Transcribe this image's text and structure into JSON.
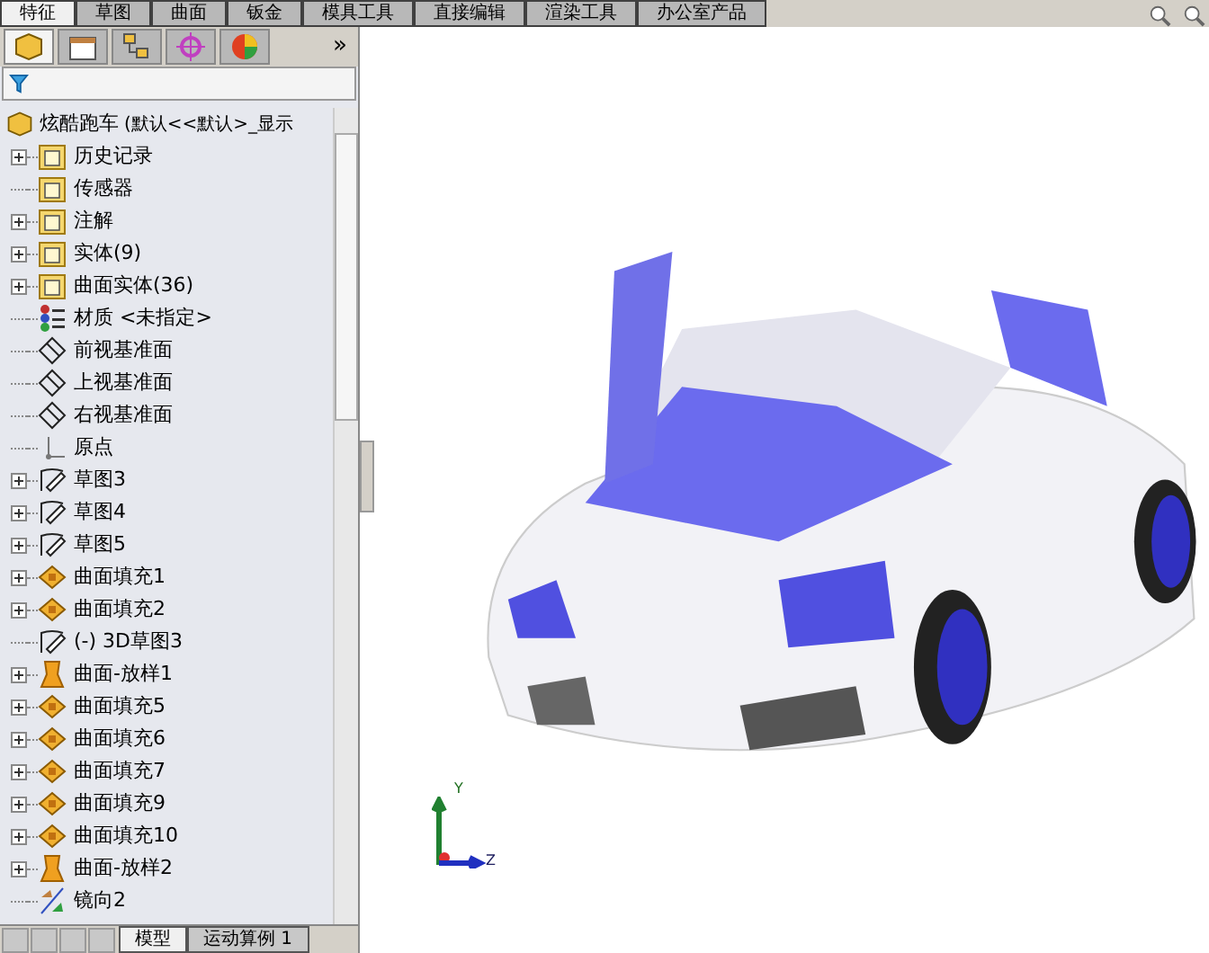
{
  "command_tabs": [
    {
      "label": "特征",
      "selected": true
    },
    {
      "label": "草图",
      "selected": false
    },
    {
      "label": "曲面",
      "selected": false
    },
    {
      "label": "钣金",
      "selected": false
    },
    {
      "label": "模具工具",
      "selected": false
    },
    {
      "label": "直接编辑",
      "selected": false
    },
    {
      "label": "渲染工具",
      "selected": false
    },
    {
      "label": "办公室产品",
      "selected": false
    }
  ],
  "panel_tabs": [
    {
      "kind": "feature",
      "selected": true
    },
    {
      "kind": "property",
      "selected": false
    },
    {
      "kind": "config",
      "selected": false
    },
    {
      "kind": "dim",
      "selected": false
    },
    {
      "kind": "display",
      "selected": false
    }
  ],
  "panel_more": "»",
  "tree": {
    "root": {
      "label": "炫酷跑车",
      "config": "(默认<<默认>_显示"
    },
    "items": [
      {
        "label": "历史记录",
        "kind": "history",
        "expandable": true
      },
      {
        "label": "传感器",
        "kind": "sensor",
        "expandable": false
      },
      {
        "label": "注解",
        "kind": "annotation",
        "expandable": true
      },
      {
        "label": "实体(9)",
        "kind": "solid",
        "expandable": true
      },
      {
        "label": "曲面实体(36)",
        "kind": "surfacefolder",
        "expandable": true
      },
      {
        "label": "材质 <未指定>",
        "kind": "material",
        "expandable": false
      },
      {
        "label": "前视基准面",
        "kind": "plane",
        "expandable": false
      },
      {
        "label": "上视基准面",
        "kind": "plane",
        "expandable": false
      },
      {
        "label": "右视基准面",
        "kind": "plane",
        "expandable": false
      },
      {
        "label": "原点",
        "kind": "origin",
        "expandable": false
      },
      {
        "label": "草图3",
        "kind": "sketch",
        "expandable": true
      },
      {
        "label": "草图4",
        "kind": "sketch",
        "expandable": true
      },
      {
        "label": "草图5",
        "kind": "sketch",
        "expandable": true
      },
      {
        "label": "曲面填充1",
        "kind": "fill",
        "expandable": true
      },
      {
        "label": "曲面填充2",
        "kind": "fill",
        "expandable": true
      },
      {
        "label": "(-) 3D草图3",
        "kind": "sketch3d",
        "expandable": false
      },
      {
        "label": "曲面-放样1",
        "kind": "loft",
        "expandable": true
      },
      {
        "label": "曲面填充5",
        "kind": "fill",
        "expandable": true
      },
      {
        "label": "曲面填充6",
        "kind": "fill",
        "expandable": true
      },
      {
        "label": "曲面填充7",
        "kind": "fill",
        "expandable": true
      },
      {
        "label": "曲面填充9",
        "kind": "fill",
        "expandable": true
      },
      {
        "label": "曲面填充10",
        "kind": "fill",
        "expandable": true
      },
      {
        "label": "曲面-放样2",
        "kind": "loft",
        "expandable": true
      },
      {
        "label": "镜向2",
        "kind": "mirror",
        "expandable": false
      }
    ]
  },
  "bottom_tabs": [
    {
      "label": "模型",
      "selected": true
    },
    {
      "label": "运动算例 1",
      "selected": false
    }
  ],
  "triad": {
    "y": "Y",
    "z": "Z"
  }
}
